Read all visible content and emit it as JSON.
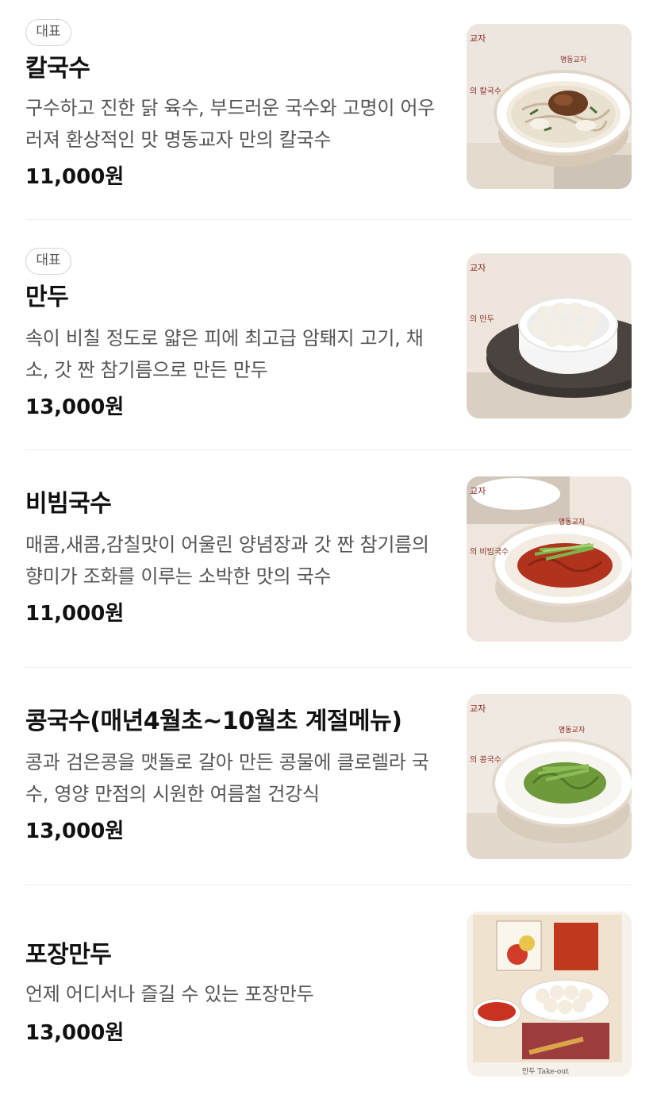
{
  "menu": {
    "items": [
      {
        "badge": "대표",
        "name": "칼국수",
        "description": "구수하고 진한 닭 육수, 부드러운 국수와 고명이 어우러져 환상적인 맛 명동교자 만의 칼국수",
        "price": "11,000원",
        "image_icon": "kalguksu-photo"
      },
      {
        "badge": "대표",
        "name": "만두",
        "description": "속이 비칠 정도로 얇은 피에 최고급 암퇘지 고기, 채소, 갓 짠 참기름으로 만든 만두",
        "price": "13,000원",
        "image_icon": "mandu-photo"
      },
      {
        "name": "비빔국수",
        "description": "매콤,새콤,감칠맛이 어울린 양념장과 갓 짠 참기름의 향미가 조화를 이루는 소박한 맛의 국수",
        "price": "11,000원",
        "image_icon": "bibimguksu-photo"
      },
      {
        "name": "콩국수(매년4월초~10월초 계절메뉴)",
        "description": "콩과 검은콩을 맷돌로 갈아 만든 콩물에 클로렐라 국수, 영양 만점의 시원한 여름철 건강식",
        "price": "13,000원",
        "image_icon": "kongguksu-photo"
      },
      {
        "name": "포장만두",
        "description": "언제 어디서나 즐길 수 있는 포장만두",
        "price": "13,000원",
        "image_icon": "takeout-mandu-photo"
      }
    ]
  }
}
